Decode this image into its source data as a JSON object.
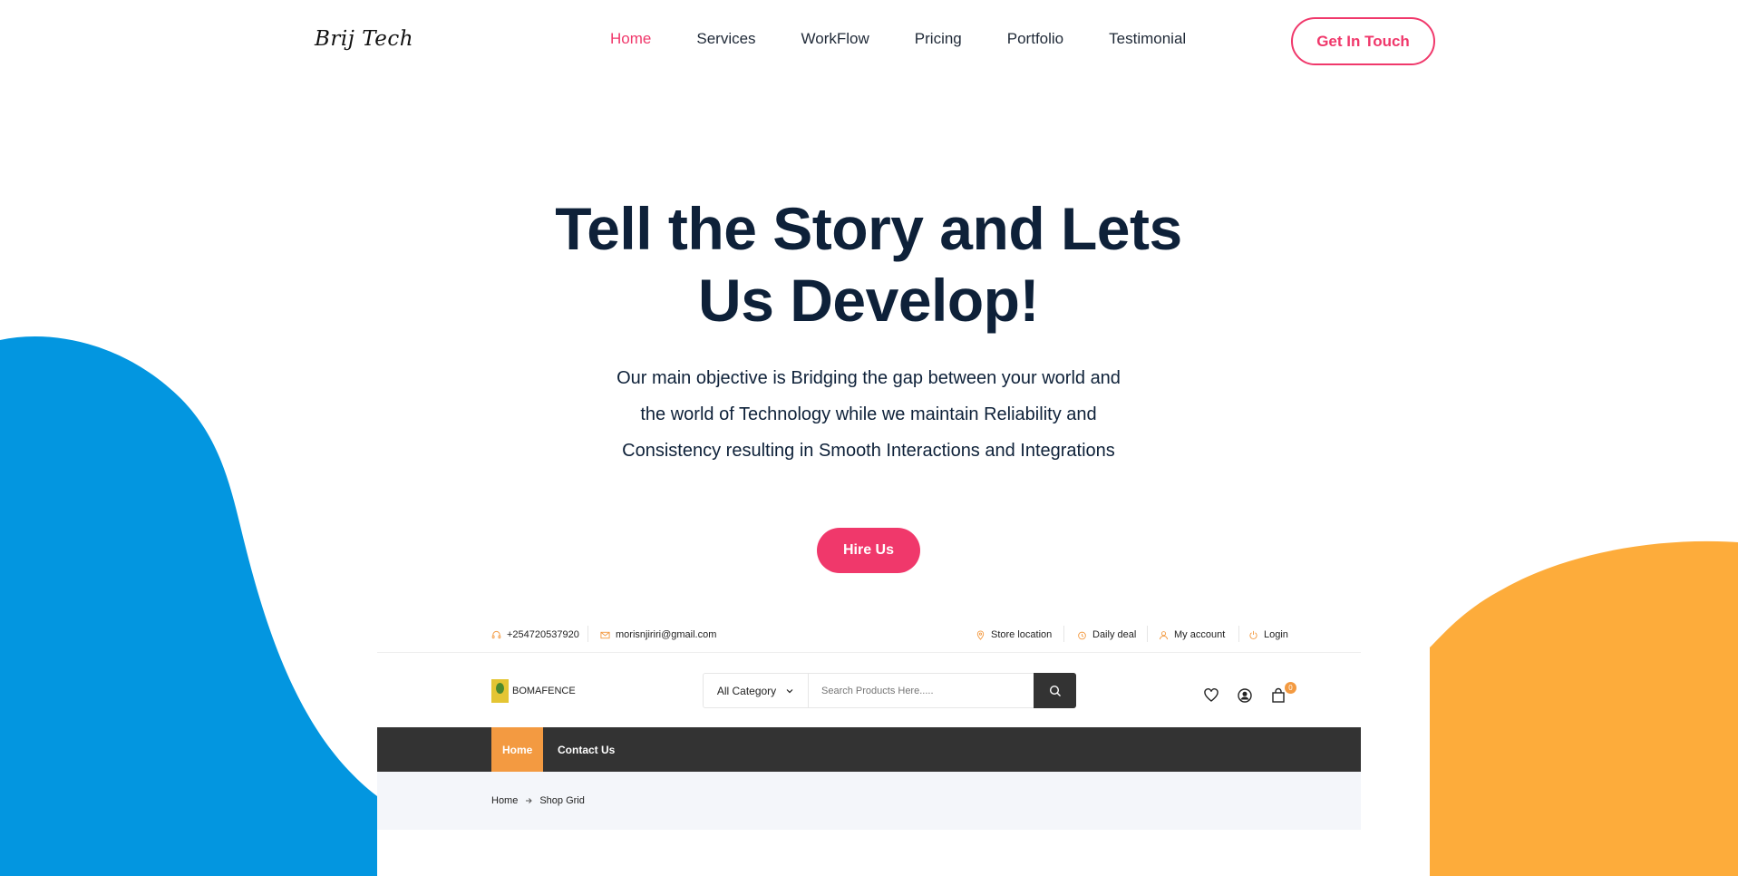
{
  "brand": {
    "logo": "Brij Tech"
  },
  "nav": {
    "items": [
      {
        "label": "Home",
        "active": true
      },
      {
        "label": "Services",
        "active": false
      },
      {
        "label": "WorkFlow",
        "active": false
      },
      {
        "label": "Pricing",
        "active": false
      },
      {
        "label": "Portfolio",
        "active": false
      },
      {
        "label": "Testimonial",
        "active": false
      }
    ],
    "cta_label": "Get In Touch"
  },
  "hero": {
    "title_line1": "Tell the Story and Lets",
    "title_line2": "Us Develop!",
    "subtitle": "Our main objective is Bridging the gap between your world and the world of Technology while we maintain Reliability and Consistency resulting in Smooth Interactions and Integrations",
    "button_label": "Hire Us"
  },
  "preview": {
    "topbar": {
      "phone": "+254720537920",
      "email": "morisnjiriri@gmail.com",
      "store_location": "Store location",
      "daily_deal": "Daily deal",
      "my_account": "My account",
      "login": "Login"
    },
    "header": {
      "logo_text": "BOMAFENCE",
      "category_label": "All Category",
      "search_placeholder": "Search Products Here.....",
      "cart_count": "0"
    },
    "menu": {
      "home": "Home",
      "contact": "Contact Us"
    },
    "breadcrumb": {
      "home": "Home",
      "current": "Shop Grid"
    }
  },
  "colors": {
    "accent": "#f0386b",
    "heading": "#0e2139",
    "blob_blue": "#0396e0",
    "blob_orange": "#fdac3b",
    "shop_orange": "#f39a41",
    "shop_dark": "#333333"
  }
}
